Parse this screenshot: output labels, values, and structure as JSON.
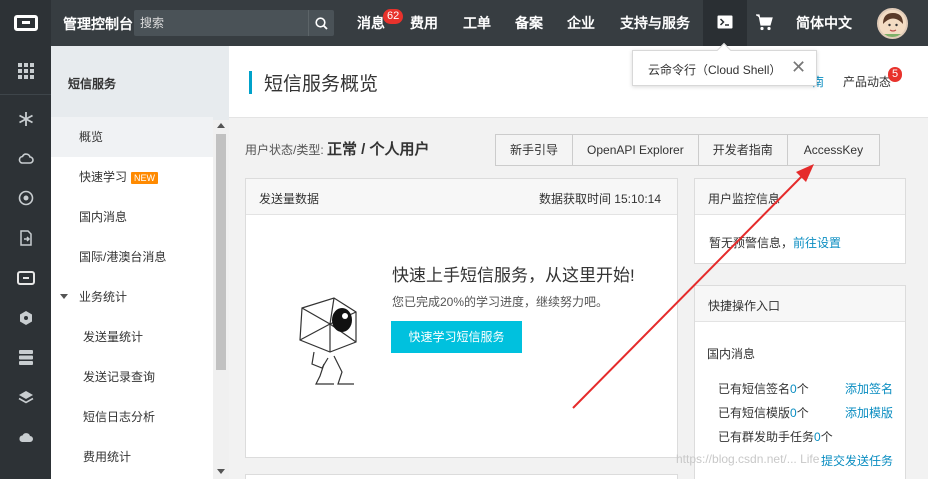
{
  "topbar": {
    "title": "管理控制台",
    "search_placeholder": "搜索",
    "nav": {
      "messages": "消息",
      "messages_badge": "62",
      "fees": "费用",
      "tickets": "工单",
      "filing": "备案",
      "enterprise": "企业",
      "support": "支持与服务",
      "language": "简体中文"
    }
  },
  "sidebar": {
    "title": "短信服务",
    "items": [
      {
        "label": "概览"
      },
      {
        "label": "快速学习",
        "tag": "NEW"
      },
      {
        "label": "国内消息"
      },
      {
        "label": "国际/港澳台消息"
      },
      {
        "label": "业务统计"
      },
      {
        "label": "发送量统计"
      },
      {
        "label": "发送记录查询"
      },
      {
        "label": "短信日志分析"
      },
      {
        "label": "费用统计"
      }
    ]
  },
  "header": {
    "title": "短信服务概览",
    "doc_link": "南",
    "news": "产品动态",
    "news_badge": "5"
  },
  "status": {
    "label": "用户状态/类型:",
    "value": "正常 / 个人用户"
  },
  "tabs": [
    "新手引导",
    "OpenAPI Explorer",
    "开发者指南",
    "AccessKey"
  ],
  "send_card": {
    "title": "发送量数据",
    "time": "数据获取时间 15:10:14",
    "hero_title": "快速上手短信服务，从这里开始!",
    "hero_sub": "您已完成20%的学习进度，继续努力吧。",
    "hero_button": "快速学习短信服务"
  },
  "monitor_card": {
    "title": "用户监控信息",
    "text": "暂无预警信息，",
    "link": "前往设置"
  },
  "quick_card": {
    "title": "快捷操作入口",
    "section": "国内消息",
    "rows": [
      {
        "prefix": "已有短信签名",
        "count": "0",
        "suffix": "个",
        "action": "添加签名"
      },
      {
        "prefix": "已有短信模版",
        "count": "0",
        "suffix": "个",
        "action": "添加模版"
      },
      {
        "prefix": "已有群发助手任务",
        "count": "0",
        "suffix": "个",
        "action": ""
      }
    ],
    "action4": "提交发送任务"
  },
  "popup": {
    "text": "云命令行（Cloud Shell）",
    "close": "✕"
  },
  "watermark": "https://blog.csdn.net/... Life",
  "colors": {
    "topbar": "#373d41",
    "rail": "#2d3236",
    "accent": "#00c1de",
    "link": "#0a8dc1",
    "badge": "#e8322c",
    "arrow": "#e52b2b"
  }
}
